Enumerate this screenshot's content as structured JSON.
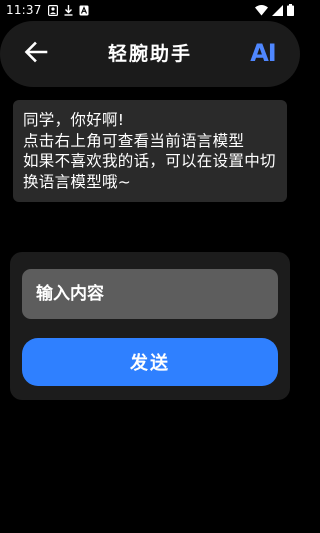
{
  "status_bar": {
    "time": "11:37",
    "left_icons": [
      "portrait-icon",
      "download-icon",
      "font-a-icon"
    ],
    "right_icons": [
      "wifi-icon",
      "signal-icon",
      "battery-icon"
    ]
  },
  "header": {
    "title": "轻腕助手",
    "ai_label": "AI",
    "back_icon": "arrow-left-icon"
  },
  "message": {
    "text": "同学，你好啊!\n点击右上角可查看当前语言模型\n如果不喜欢我的话，可以在设置中切换语言模型哦~"
  },
  "input": {
    "placeholder": "输入内容",
    "value": ""
  },
  "send": {
    "label": "发送"
  },
  "colors": {
    "background": "#000000",
    "header_bg": "#1b1b1b",
    "card_bg": "#2a2a2a",
    "panel_bg": "#1c1c1c",
    "input_bg": "#5d5d5d",
    "accent": "#2f80ff",
    "ai_color": "#4f87ff"
  }
}
